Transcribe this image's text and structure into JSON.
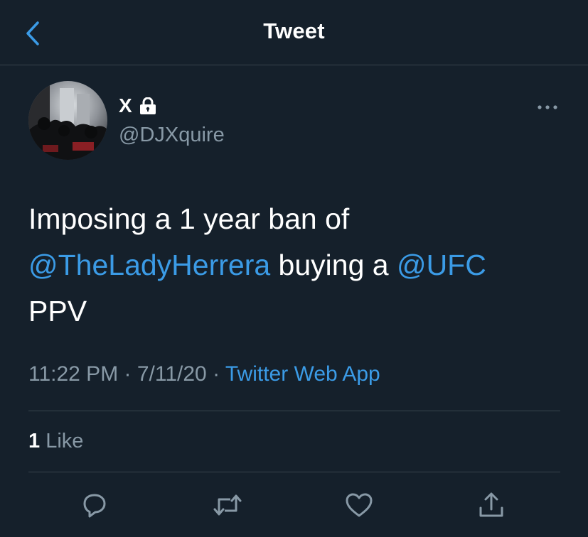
{
  "header": {
    "title": "Tweet",
    "back_icon": "chevron-left-icon"
  },
  "tweet": {
    "author": {
      "display_name": "X",
      "handle": "@DJXquire",
      "protected_icon": "lock-icon",
      "avatar": "avatar-photo"
    },
    "more_icon": "more-horizontal-icon",
    "text": {
      "line1": "Imposing a 1 year ban of",
      "mention1": "@TheLadyHerrera",
      "mid": " buying a ",
      "mention2": "@UFC",
      "end": "PPV"
    },
    "time": "11:22 PM",
    "sep1": " · ",
    "date": "7/11/20",
    "sep2": " · ",
    "source": "Twitter Web App",
    "likes": {
      "count": "1",
      "label": "Like"
    }
  },
  "actions": [
    {
      "icon": "reply-icon"
    },
    {
      "icon": "retweet-icon"
    },
    {
      "icon": "like-icon"
    },
    {
      "icon": "share-icon"
    }
  ],
  "colors": {
    "background": "#15202b",
    "divider": "#38444d",
    "secondary_text": "#8899a6",
    "accent": "#3b9be6"
  }
}
